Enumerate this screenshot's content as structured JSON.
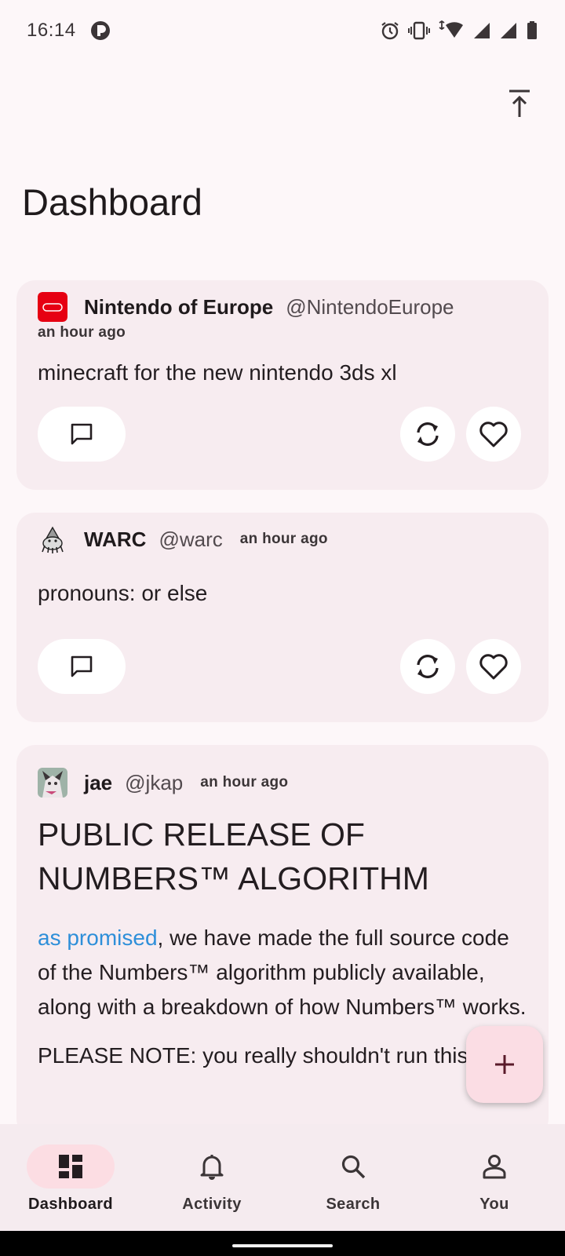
{
  "status_bar": {
    "time": "16:14"
  },
  "header": {
    "title": "Dashboard"
  },
  "posts": [
    {
      "author": "Nintendo of Europe",
      "handle": "@NintendoEurope",
      "time": "an hour ago",
      "body": "minecraft for the new nintendo 3ds xl"
    },
    {
      "author": "WARC",
      "handle": "@warc",
      "time": "an hour ago",
      "body": "pronouns: or else"
    },
    {
      "author": "jae",
      "handle": "@jkap",
      "time": "an hour ago",
      "headline": "PUBLIC RELEASE OF NUMBERS™ ALGORITHM",
      "link_text": "as promised",
      "body_rest": ", we have made the full source code of the Numbers™ algorithm publicly available, along with a breakdown of how Numbers™ works.",
      "note": "PLEASE NOTE: you really shouldn't run this"
    }
  ],
  "bottom_nav": {
    "items": [
      {
        "label": "Dashboard",
        "icon": "dashboard-icon",
        "active": true
      },
      {
        "label": "Activity",
        "icon": "bell-icon",
        "active": false
      },
      {
        "label": "Search",
        "icon": "search-icon",
        "active": false
      },
      {
        "label": "You",
        "icon": "person-icon",
        "active": false
      }
    ]
  },
  "colors": {
    "background": "#fdf7f9",
    "card": "#f7ecf0",
    "accent_pill": "#fcdde3",
    "link": "#2e8fd9",
    "fab": "#fbdde4"
  }
}
